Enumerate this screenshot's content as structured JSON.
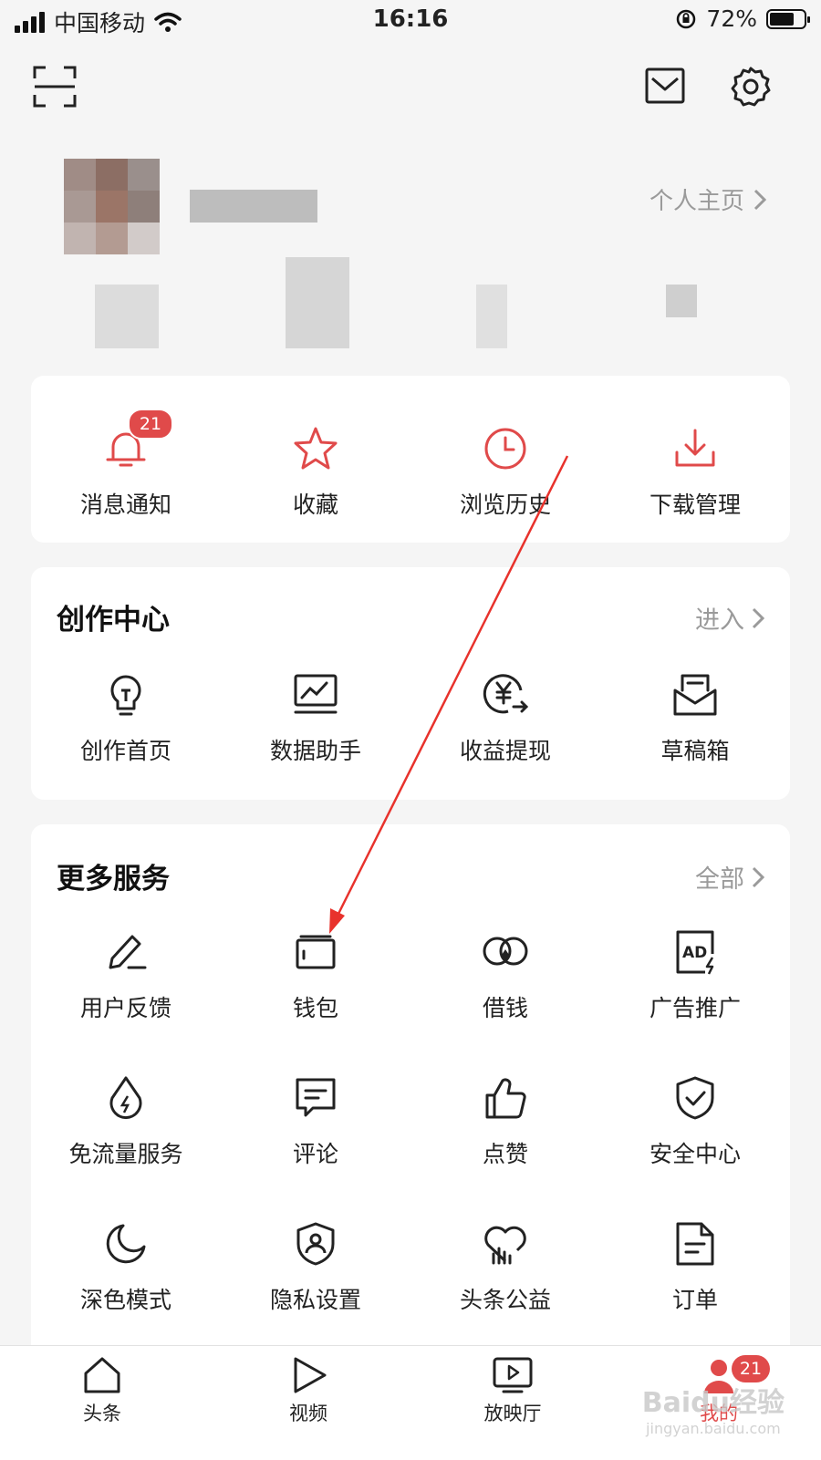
{
  "status_bar": {
    "carrier": "中国移动",
    "time": "16:16",
    "battery_percent": "72%",
    "battery_level": 0.72
  },
  "header": {
    "scan_icon": "scan-icon",
    "mail_icon": "mail-icon",
    "settings_icon": "gear-icon"
  },
  "profile": {
    "home_link": "个人主页"
  },
  "quick_actions": [
    {
      "label": "消息通知",
      "icon": "bell-icon",
      "badge": "21"
    },
    {
      "label": "收藏",
      "icon": "star-icon"
    },
    {
      "label": "浏览历史",
      "icon": "clock-icon"
    },
    {
      "label": "下载管理",
      "icon": "download-icon"
    }
  ],
  "creation_center": {
    "title": "创作中心",
    "enter_link": "进入",
    "items": [
      {
        "label": "创作首页",
        "icon": "lightbulb-icon"
      },
      {
        "label": "数据助手",
        "icon": "chart-monitor-icon"
      },
      {
        "label": "收益提现",
        "icon": "yen-withdraw-icon"
      },
      {
        "label": "草稿箱",
        "icon": "draft-box-icon"
      }
    ]
  },
  "more_services": {
    "title": "更多服务",
    "all_link": "全部",
    "items": [
      {
        "label": "用户反馈",
        "icon": "pen-feedback-icon"
      },
      {
        "label": "钱包",
        "icon": "wallet-icon"
      },
      {
        "label": "借钱",
        "icon": "loan-icon"
      },
      {
        "label": "广告推广",
        "icon": "ad-icon"
      },
      {
        "label": "免流量服务",
        "icon": "data-drop-icon"
      },
      {
        "label": "评论",
        "icon": "comment-icon"
      },
      {
        "label": "点赞",
        "icon": "thumbs-up-icon"
      },
      {
        "label": "安全中心",
        "icon": "shield-check-icon"
      },
      {
        "label": "深色模式",
        "icon": "moon-icon"
      },
      {
        "label": "隐私设置",
        "icon": "privacy-shield-icon"
      },
      {
        "label": "头条公益",
        "icon": "charity-heart-icon"
      },
      {
        "label": "订单",
        "icon": "order-doc-icon"
      }
    ]
  },
  "tabbar": {
    "tabs": [
      {
        "label": "头条",
        "icon": "home-icon"
      },
      {
        "label": "视频",
        "icon": "play-icon"
      },
      {
        "label": "放映厅",
        "icon": "screen-play-icon"
      },
      {
        "label": "我的",
        "icon": "person-icon",
        "badge": "21",
        "active": true
      }
    ]
  },
  "watermark": {
    "text": "Baidu经验",
    "sub": "jingyan.baidu.com"
  },
  "colors": {
    "accent": "#e04a4a",
    "muted": "#9a9a9a",
    "background": "#f5f5f5",
    "annotation_arrow": "#e8322c"
  }
}
